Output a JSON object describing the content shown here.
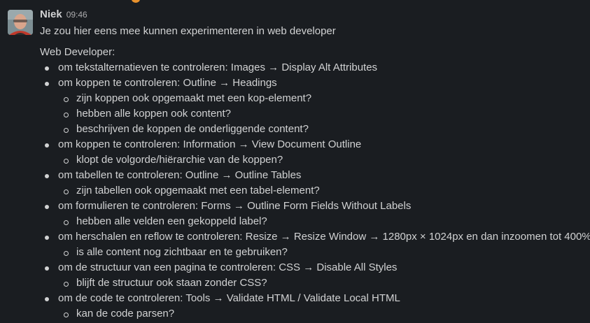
{
  "message": {
    "author": "Niek",
    "time": "09:46",
    "intro": "Je zou hier eens mee kunnen experimenteren in web developer",
    "list_heading": "Web Developer:",
    "items": [
      {
        "text": "om tekstalternatieven te controleren: Images → Display Alt Attributes",
        "level": 1
      },
      {
        "text": "om koppen te controleren: Outline → Headings",
        "level": 1
      },
      {
        "text": "zijn koppen ook opgemaakt met een kop-element?",
        "level": 2
      },
      {
        "text": "hebben alle koppen ook content?",
        "level": 2
      },
      {
        "text": "beschrijven de koppen de onderliggende content?",
        "level": 2
      },
      {
        "text": "om koppen te controleren: Information → View Document Outline",
        "level": 1
      },
      {
        "text": "klopt de volgorde/hiërarchie van de koppen?",
        "level": 2
      },
      {
        "text": "om tabellen te controleren: Outline → Outline Tables",
        "level": 1
      },
      {
        "text": "zijn tabellen ook opgemaakt met een tabel-element?",
        "level": 2
      },
      {
        "text": "om formulieren te controleren: Forms → Outline Form Fields Without Labels",
        "level": 1
      },
      {
        "text": "hebben alle velden een gekoppeld label?",
        "level": 2
      },
      {
        "text": "om herschalen en reflow te controleren: Resize → Resize Window → 1280px × 1024px en dan inzoomen tot 400%",
        "level": 1
      },
      {
        "text": "is alle content nog zichtbaar en te gebruiken?",
        "level": 2
      },
      {
        "text": "om de structuur van een pagina te controleren: CSS → Disable All Styles",
        "level": 1
      },
      {
        "text": "blijft de structuur ook staan zonder CSS?",
        "level": 2
      },
      {
        "text": "om de code te controleren: Tools → Validate HTML / Validate Local HTML",
        "level": 1
      },
      {
        "text": "kan de code parsen?",
        "level": 2
      }
    ]
  },
  "colors": {
    "background": "#1a1d21",
    "text": "#d1d2d3",
    "timestamp": "#ababad"
  }
}
